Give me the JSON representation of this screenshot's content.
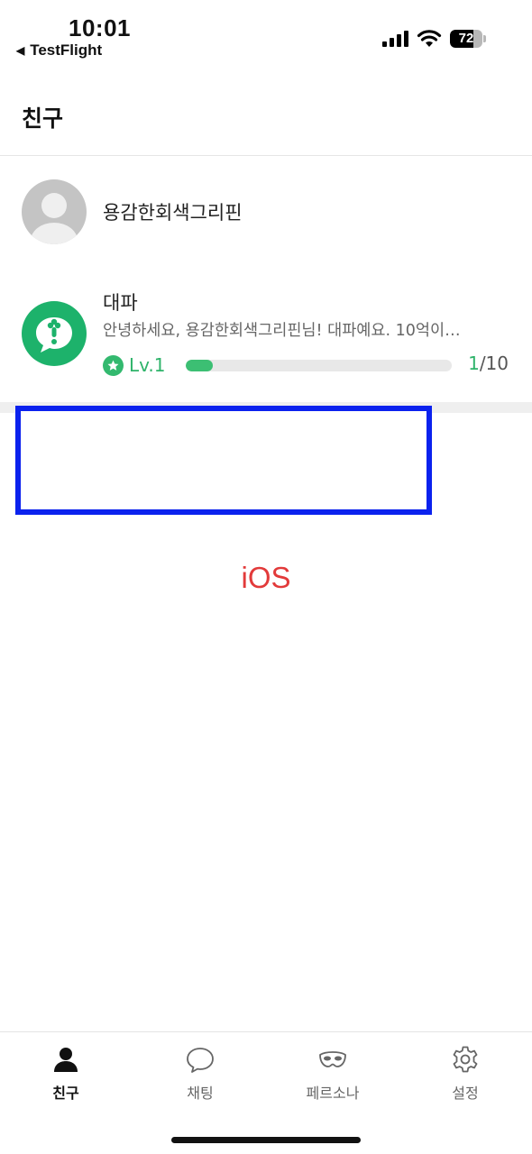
{
  "status_bar": {
    "time": "10:01",
    "back_app": "TestFlight",
    "battery_percent": "72",
    "battery_level": 72,
    "icons": [
      "cellular-signal-icon",
      "wifi-icon",
      "battery-icon"
    ]
  },
  "header": {
    "title": "친구"
  },
  "friends": [
    {
      "name": "용감한회색그리핀",
      "avatar": "default-person-icon"
    }
  ],
  "bot": {
    "name": "대파",
    "message": "안녕하세요, 용감한회색그리핀님! 대파예요. 10억이…",
    "level": "Lv.1",
    "progress_current": "1",
    "progress_total": "/10",
    "progress_fraction": 0.1,
    "avatar_color": "#1db26b"
  },
  "platform_label": "iOS",
  "tab_bar": {
    "tabs": [
      {
        "label": "친구",
        "icon": "person-icon",
        "active": true
      },
      {
        "label": "채팅",
        "icon": "chat-bubble-icon",
        "active": false
      },
      {
        "label": "페르소나",
        "icon": "mask-icon",
        "active": false
      },
      {
        "label": "설정",
        "icon": "gear-icon",
        "active": false
      }
    ]
  },
  "colors": {
    "accent_green": "#2eb36a",
    "highlight_frame": "#0b22ee",
    "platform_label": "#e23a3a"
  }
}
